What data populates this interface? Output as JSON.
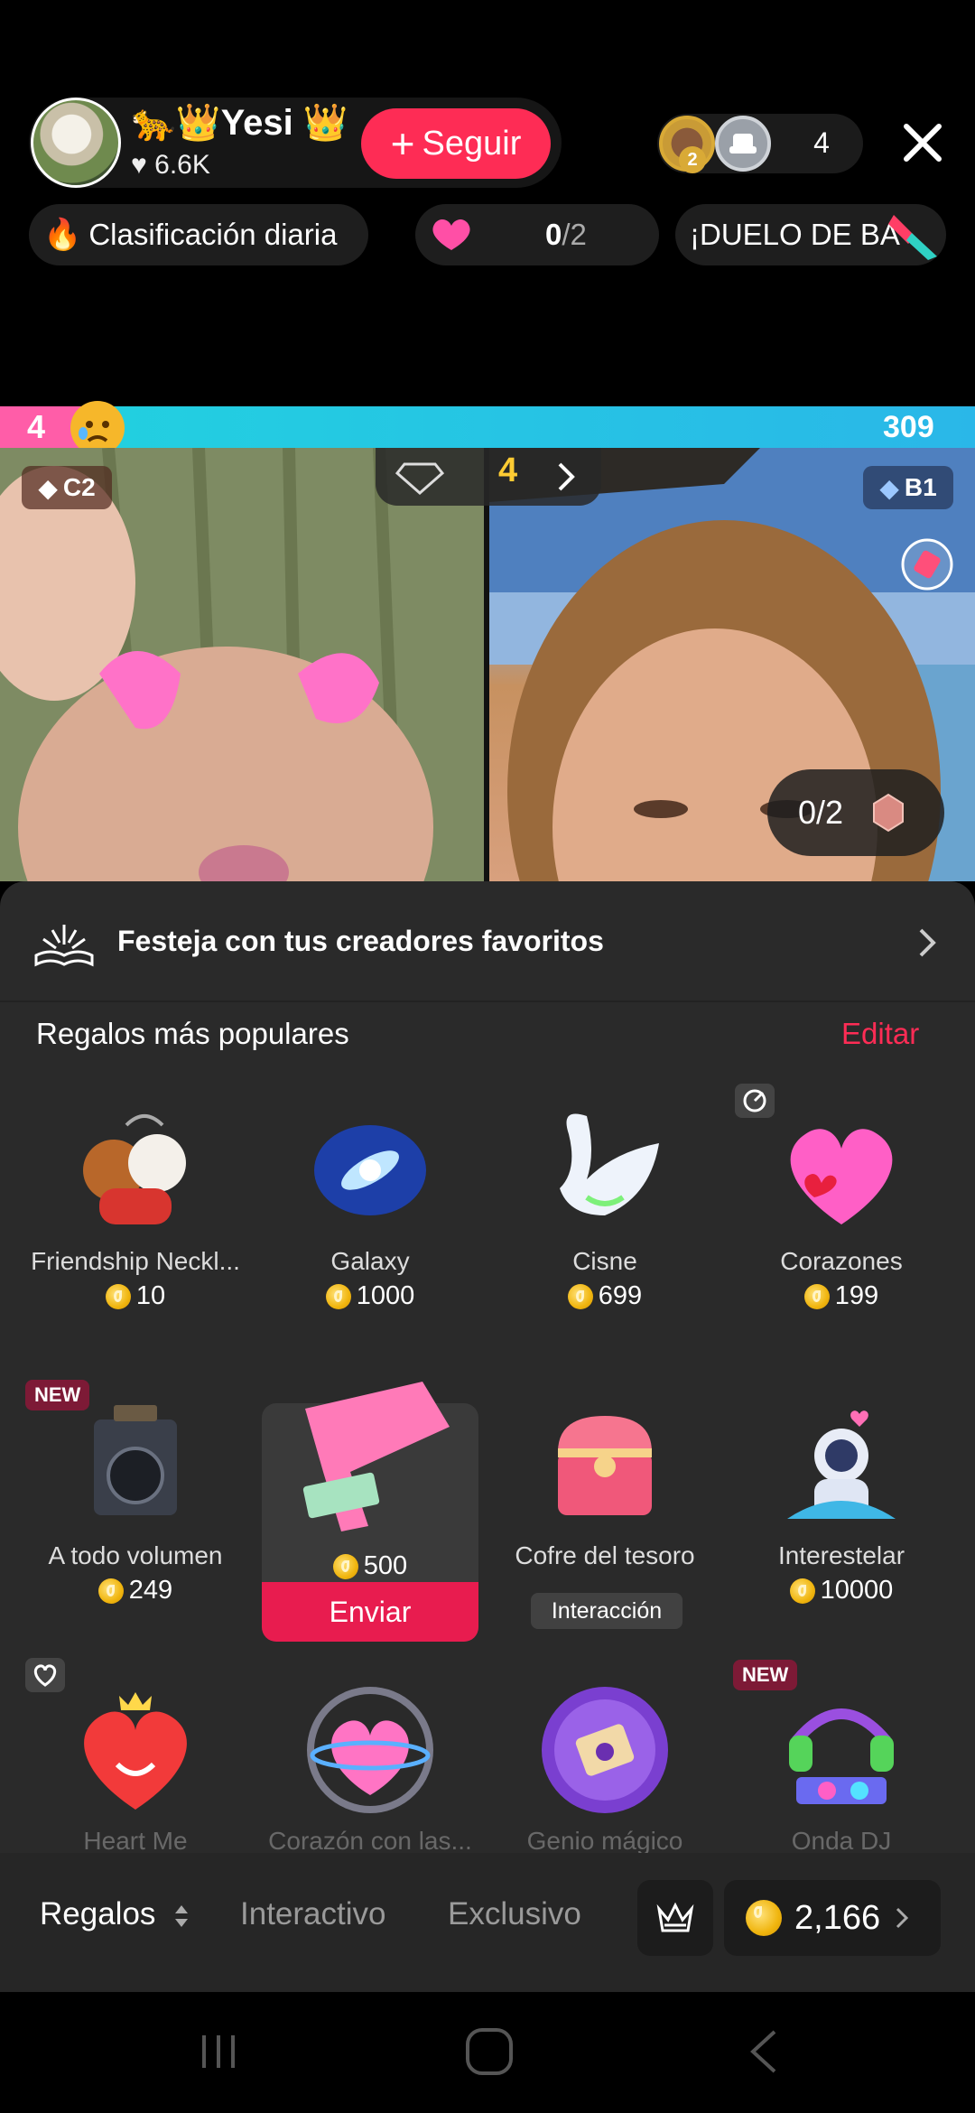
{
  "header": {
    "creator_name": "🐆👑Yesi 👑",
    "likes": "6.6K",
    "follow_label": "Seguir",
    "viewer_badge_rank": "2",
    "viewer_count": "4"
  },
  "chips": {
    "ranking": "Clasificación diaria",
    "goal_current": "0",
    "goal_total": "/2",
    "duel": "¡DUELO DE BA"
  },
  "battle": {
    "left_score": "4",
    "right_score": "309",
    "left_badge": "C2",
    "right_badge": "B1",
    "center_rank": "4",
    "goal_counter": "0/2"
  },
  "sheet": {
    "banner": "Festeja con tus creadores favoritos",
    "section_title": "Regalos más populares",
    "edit_label": "Editar",
    "new_label": "NEW",
    "gifts_row1": [
      {
        "name": "Friendship Neckl...",
        "price": "10"
      },
      {
        "name": "Galaxy",
        "price": "1000"
      },
      {
        "name": "Cisne",
        "price": "699"
      },
      {
        "name": "Corazones",
        "price": "199"
      }
    ],
    "gifts_row2": [
      {
        "name": "A todo volumen",
        "price": "249"
      },
      {
        "name": "",
        "price": "500"
      },
      {
        "name": "Cofre del tesoro",
        "tag": "Interacción"
      },
      {
        "name": "Interestelar",
        "price": "10000"
      }
    ],
    "send_label": "Enviar",
    "gifts_row3": [
      {
        "name": "Heart Me"
      },
      {
        "name": "Corazón con las..."
      },
      {
        "name": "Genio mágico"
      },
      {
        "name": "Onda DJ"
      }
    ]
  },
  "bottom_bar": {
    "tab_gifts": "Regalos",
    "tab_interactive": "Interactivo",
    "tab_exclusive": "Exclusivo",
    "balance": "2,166"
  },
  "colors": {
    "accent": "#fe2c55",
    "coin": "#f0b50e",
    "sheet_bg": "#2a2a2a"
  }
}
